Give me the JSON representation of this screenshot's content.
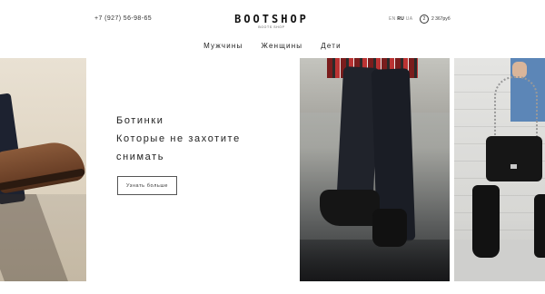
{
  "header": {
    "phone": "+7 (927) 56-98-65",
    "logo": "BOOTSHOP",
    "logo_sub": "BOOTS SHOP",
    "lang_en": "EN",
    "lang_ru": "RU",
    "lang_ua": "UA",
    "cart_count": "2",
    "cart_total": "2 367руб"
  },
  "nav": {
    "items": [
      "Мужчины",
      "Женщины",
      "Дети"
    ]
  },
  "hero": {
    "line1": "Ботинки",
    "line2": "Которые не захотите",
    "line3": "снимать",
    "cta_label": "Узнать больше"
  },
  "icons": {
    "cart": "cart-icon"
  }
}
